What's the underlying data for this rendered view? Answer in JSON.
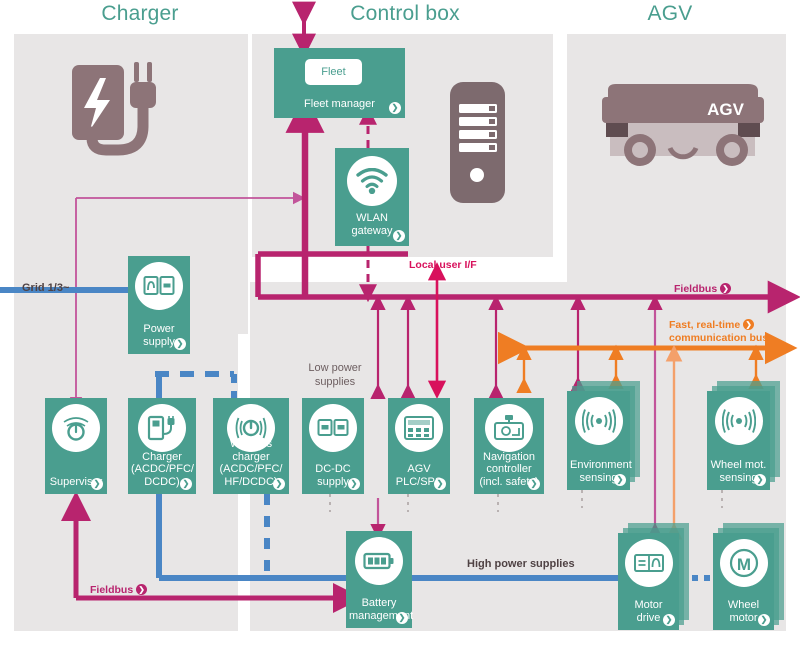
{
  "sections": [
    {
      "id": "charger",
      "title": "Charger"
    },
    {
      "id": "controlbox",
      "title": "Control box"
    },
    {
      "id": "agv",
      "title": "AGV"
    }
  ],
  "illustrations": {
    "charger_plug": "charging-station-plug-illustration",
    "server_tower": "server-tower-illustration",
    "agv_vehicle": "agv-vehicle-illustration",
    "agv_vehicle_label": "AGV"
  },
  "nodes": [
    {
      "id": "fleet-manager",
      "label": "Fleet manager",
      "inner_badge": "Fleet",
      "icon": "fleet-badge"
    },
    {
      "id": "wlan-gateway",
      "label": "WLAN\ngateway",
      "line1": "WLAN",
      "line2": "gateway",
      "icon": "wifi-icon"
    },
    {
      "id": "power-supply",
      "label": "Power supply",
      "line1": "Power",
      "line2": "supply",
      "icon": "power-supply-icon"
    },
    {
      "id": "supervisor",
      "label": "Supervisor",
      "line1": "Supervisor",
      "icon": "supervisor-gauge-icon"
    },
    {
      "id": "charger",
      "label": "Charger (ACDC/PFC/DCDC)",
      "line1": "Charger",
      "line2": "(ACDC/PFC/",
      "line3": "DCDC)",
      "icon": "charger-plug-icon"
    },
    {
      "id": "wireless-charger",
      "label": "Wireless charger (ACDC/PFC/HF/DCDC)",
      "line1": "Wireless charger",
      "line2": "(ACDC/PFC/",
      "line3": "HF/DCDC)",
      "icon": "wireless-power-icon"
    },
    {
      "id": "dcdc-supply",
      "label": "DC-DC supply",
      "line1": "DC-DC",
      "line2": "supply",
      "icon": "dcdc-icon"
    },
    {
      "id": "agv-plc",
      "label": "AGV PLC/SPS",
      "line1": "AGV",
      "line2": "PLC/SPS",
      "icon": "plc-icon"
    },
    {
      "id": "navigation-controller",
      "label": "Navigation controller (incl. safety)",
      "line1": "Navigation",
      "line2": "controller",
      "line3": "(incl. safety)",
      "icon": "navigation-icon"
    },
    {
      "id": "environment-sensing",
      "label": "Environment sensing",
      "line1": "Environment",
      "line2": "sensing",
      "icon": "sensor-wave-icon",
      "stacked": true
    },
    {
      "id": "wheel-motor-sensing",
      "label": "Wheel mot. sensing",
      "line1": "Wheel mot.",
      "line2": "sensing",
      "icon": "sensor-wave-icon",
      "stacked": true
    },
    {
      "id": "battery-management",
      "label": "Battery management",
      "line1": "Battery",
      "line2": "management",
      "icon": "battery-icon"
    },
    {
      "id": "motor-drive",
      "label": "Motor drive",
      "line1": "Motor",
      "line2": "drive",
      "icon": "inverter-icon",
      "stacked": true
    },
    {
      "id": "wheel-motor",
      "label": "Wheel motor",
      "line1": "Wheel",
      "line2": "motor",
      "icon": "motor-m-icon",
      "stacked": true
    }
  ],
  "annotations": {
    "grid_input": "Grid 1/3~",
    "low_power_supplies": "Low power supplies",
    "low_power_supplies_line1": "Low power",
    "low_power_supplies_line2": "supplies",
    "high_power_supplies": "High power supplies",
    "local_user_if": "Local user I/F",
    "fieldbus_top": "Fieldbus",
    "fieldbus_bottom": "Fieldbus",
    "fast_bus_line1": "Fast, real-time",
    "fast_bus_line2": "communication bus"
  },
  "colors": {
    "teal": "#4a9e8f",
    "panel_gray": "#e8e6e6",
    "magenta": "#b8246e",
    "pink_thin": "#c2549a",
    "red": "#d8115c",
    "orange": "#ef7d23",
    "orange_light": "#f4a06a",
    "blue": "#4a86c5",
    "mauve": "#8d7478",
    "text_dark": "#4f4244"
  }
}
